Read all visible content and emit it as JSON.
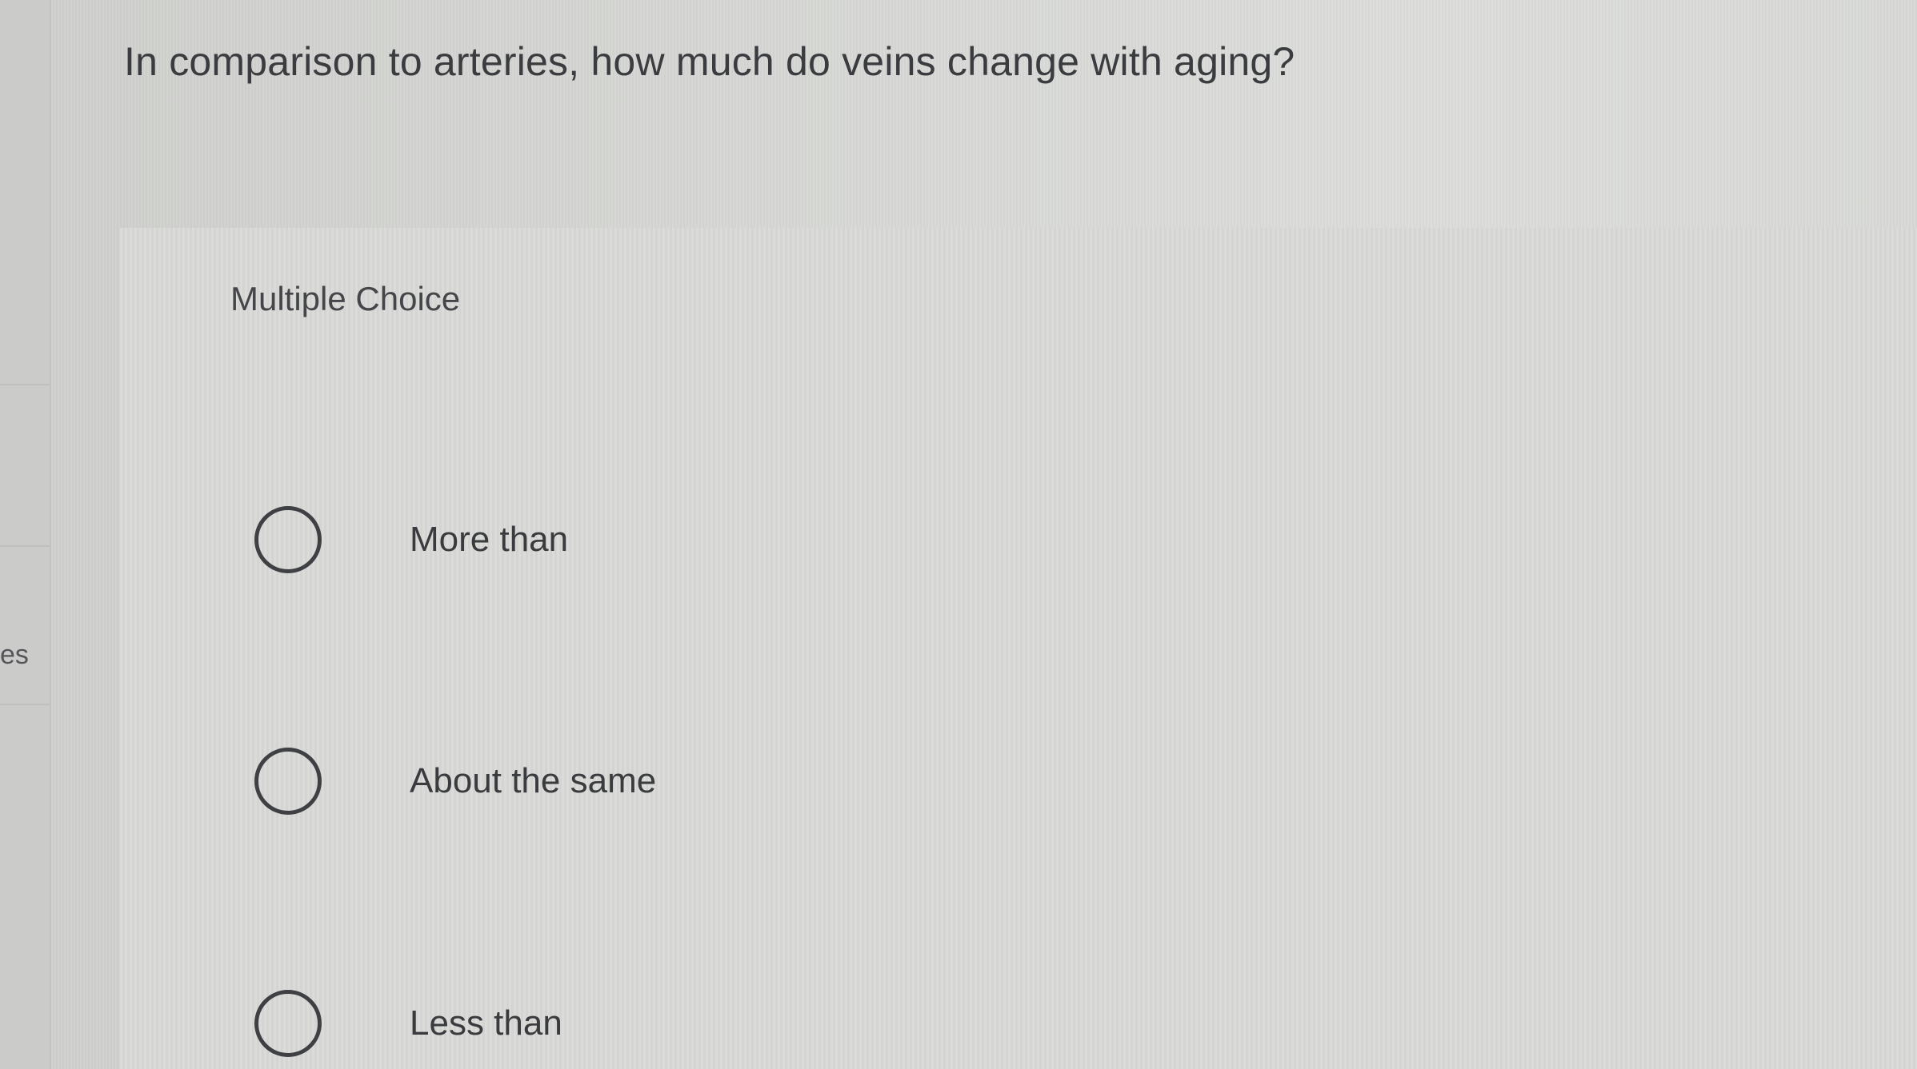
{
  "sidebar": {
    "fragment_text": "es"
  },
  "question": {
    "text": "In comparison to arteries, how much do veins change with aging?",
    "type_label": "Multiple Choice",
    "options": [
      {
        "label": "More than",
        "selected": false
      },
      {
        "label": "About the same",
        "selected": false
      },
      {
        "label": "Less than",
        "selected": false
      }
    ]
  },
  "colors": {
    "background": "#d3d4d1",
    "text": "#3a3b3e",
    "radio_border": "#3f4043"
  },
  "icons": {
    "radio": "radio-unchecked-icon"
  }
}
